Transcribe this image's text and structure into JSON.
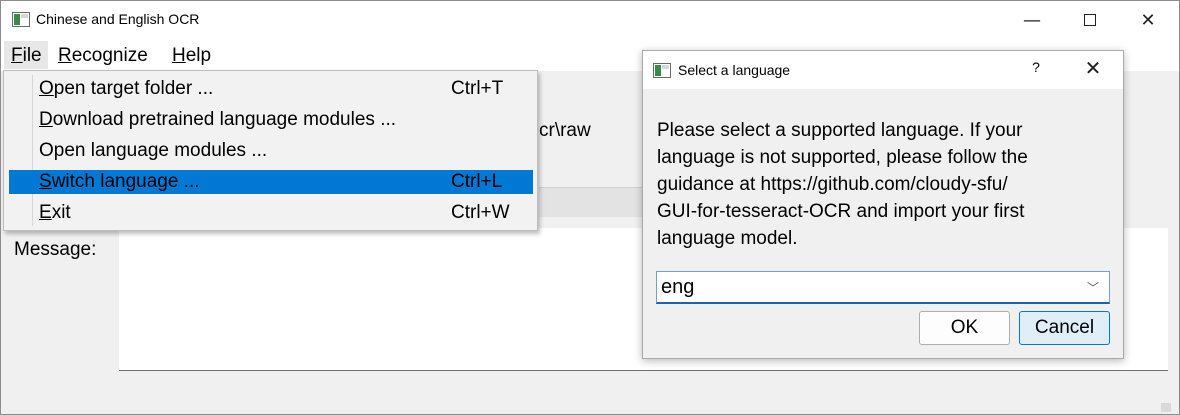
{
  "window": {
    "title": "Chinese and English OCR",
    "icon": "app-window-icon",
    "controls": {
      "minimize": "—",
      "close": "✕"
    }
  },
  "menubar": {
    "items": [
      {
        "label": "File",
        "mnemonic": "F",
        "rest": "ile"
      },
      {
        "label": "Recognize",
        "mnemonic": "R",
        "rest": "ecognize"
      },
      {
        "label": "Help",
        "mnemonic": "H",
        "rest": "elp"
      }
    ]
  },
  "file_menu": {
    "items": [
      {
        "mnemonic": "O",
        "rest": "pen target folder ...",
        "shortcut": "Ctrl+T"
      },
      {
        "mnemonic": "D",
        "rest": "ownload pretrained language modules ...",
        "shortcut": ""
      },
      {
        "mnemonic": "",
        "rest": "Open language modules ...",
        "shortcut": ""
      },
      {
        "mnemonic": "S",
        "rest": "witch language ...",
        "shortcut": "Ctrl+L"
      },
      {
        "mnemonic": "E",
        "rest": "xit",
        "shortcut": "Ctrl+W"
      }
    ],
    "selected_index": 3,
    "highlight_color": "#0078d4"
  },
  "main": {
    "path_fragment": "cr\\raw",
    "message_label": "Message:",
    "message_text": ""
  },
  "dialog": {
    "title": "Select a language",
    "help_button": "?",
    "close_button": "✕",
    "message": "Please select a supported language. If your\nlanguage is not supported, please follow the\nguidance at https://github.com/cloudy-sfu/\nGUI-for-tesseract-OCR and import your first\nlanguage model.",
    "language_select": {
      "value": "eng",
      "chevron": "﹀"
    },
    "ok_label": "OK",
    "cancel_label": "Cancel"
  }
}
